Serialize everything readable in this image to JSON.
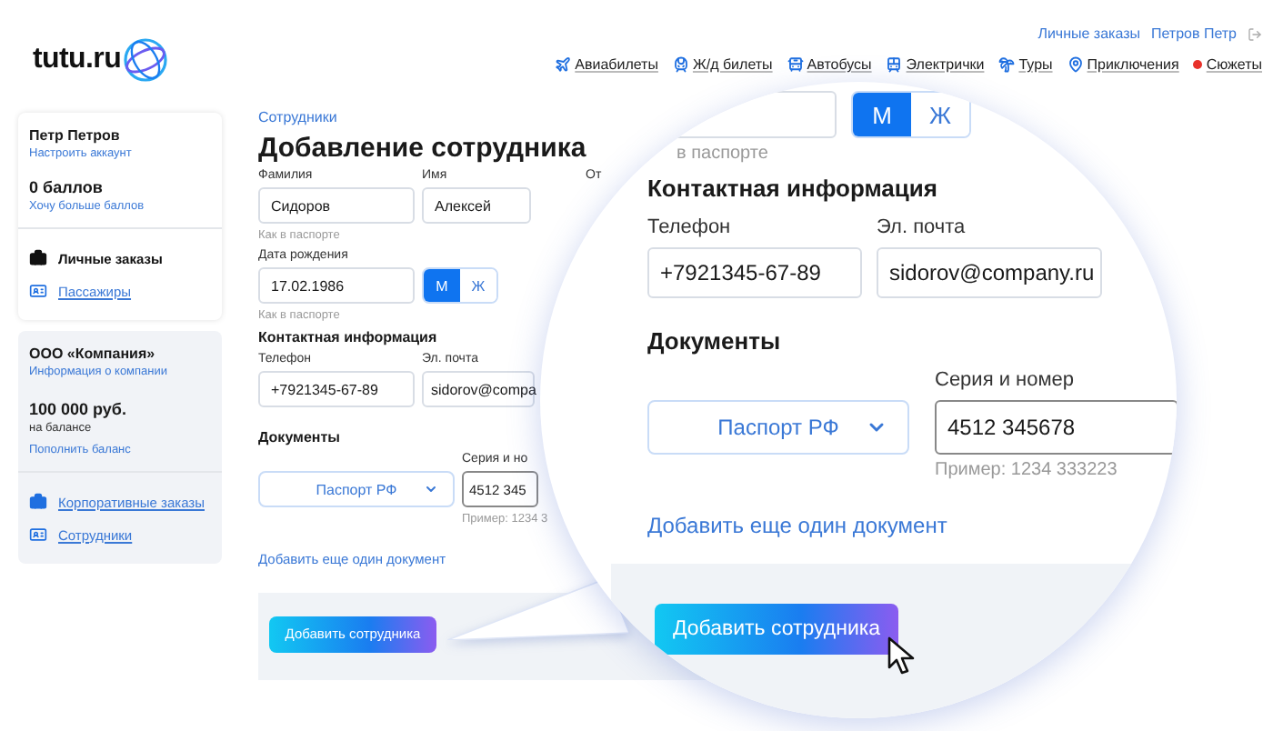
{
  "header": {
    "logo": "tutu.ru",
    "account_links": [
      {
        "label": "Личные заказы"
      },
      {
        "label": "Петров Петр"
      }
    ],
    "nav": [
      {
        "label": "Авиабилеты",
        "kind": "plane"
      },
      {
        "label": "Ж/д билеты",
        "kind": "train"
      },
      {
        "label": "Автобусы",
        "kind": "bus"
      },
      {
        "label": "Электрички",
        "kind": "tram"
      },
      {
        "label": "Туры",
        "kind": "tours"
      },
      {
        "label": "Приключения",
        "kind": "adventure"
      },
      {
        "label": "Сюжеты",
        "kind": "dot"
      }
    ]
  },
  "sidebar": {
    "profile": {
      "name": "Петр Петров",
      "account_link": "Настроить аккаунт",
      "points": "0 баллов",
      "points_link": "Хочу больше баллов",
      "links": [
        {
          "label": "Личные заказы",
          "kind": "bag"
        },
        {
          "label": "Пассажиры",
          "kind": "card"
        }
      ]
    },
    "company": {
      "name": "ООО «Компания»",
      "info_link": "Информация о компании",
      "balance": "100 000 руб.",
      "balance_note": "на балансе",
      "top_up_link": "Пополнить баланс",
      "links": [
        {
          "label": "Корпоративные заказы",
          "kind": "case"
        },
        {
          "label": "Сотрудники",
          "kind": "card"
        }
      ]
    }
  },
  "breadcrumb": "Сотрудники",
  "title": "Добавление сотрудника",
  "form": {
    "name_labels": [
      "Фамилия",
      "Имя",
      "От"
    ],
    "last_name": "Сидоров",
    "first_name": "Алексей",
    "name_hint": "Как в паспорте",
    "birth_label": "Дата рождения",
    "birth_date": "17.02.1986",
    "gender": [
      {
        "label": "М",
        "selected": true
      },
      {
        "label": "Ж",
        "selected": false
      }
    ],
    "birth_hint": "Как в паспорте",
    "contacts_heading": "Контактная информация",
    "phone_label": "Телефон",
    "email_label": "Эл. почта",
    "phone": "+7921345-67-89",
    "email": "sidorov@compa",
    "documents_heading": "Документы",
    "document_type": "Паспорт РФ",
    "number_label": "Серия и но",
    "number": "4512  345",
    "number_hint": "Пример: 1234 3",
    "add_document_link": "Добавить еще один документ",
    "submit_button": "Добавить сотрудника"
  },
  "magnifier": {
    "gender": [
      {
        "label": "М",
        "selected": true
      },
      {
        "label": "Ж",
        "selected": false
      }
    ],
    "passport_hint": "в паспорте",
    "contacts_heading": "Контактная информация",
    "phone_label": "Телефон",
    "email_label": "Эл. почта",
    "phone": "+7921345-67-89",
    "email": "sidorov@company.ru",
    "documents_heading": "Документы",
    "document_type": "Паспорт РФ",
    "number_label": "Серия и номер",
    "number": "4512  345678",
    "number_hint": "Пример: 1234 333223",
    "add_document_link": "Добавить еще один документ",
    "submit_button": "Добавить сотрудника"
  }
}
